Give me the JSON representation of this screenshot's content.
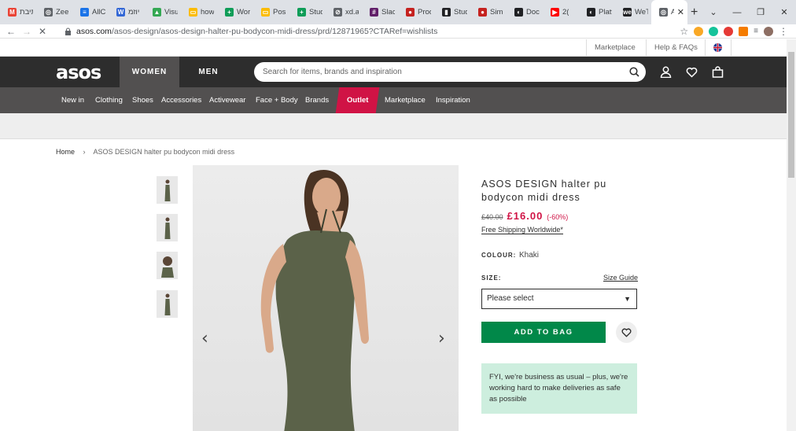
{
  "browser": {
    "tabs": [
      {
        "title": "תיבת",
        "color": "#ea4335",
        "glyph": "M"
      },
      {
        "title": "Zeek",
        "color": "#5f6368",
        "glyph": "◎"
      },
      {
        "title": "AllCu",
        "color": "#1a73e8",
        "glyph": "≡"
      },
      {
        "title": "יוזמ",
        "color": "#3367d6",
        "glyph": "W"
      },
      {
        "title": "Visua",
        "color": "#34a853",
        "glyph": "▲"
      },
      {
        "title": "how t",
        "color": "#fbbc04",
        "glyph": "▭"
      },
      {
        "title": "Work",
        "color": "#0f9d58",
        "glyph": "+"
      },
      {
        "title": "Positi",
        "color": "#fbbc04",
        "glyph": "▭"
      },
      {
        "title": "Studi",
        "color": "#0f9d58",
        "glyph": "+"
      },
      {
        "title": "xd.ad",
        "color": "#5f6368",
        "glyph": "⊘"
      },
      {
        "title": "Slack",
        "color": "#611f69",
        "glyph": "#"
      },
      {
        "title": "Prod",
        "color": "#c5221f",
        "glyph": "●"
      },
      {
        "title": "Studi",
        "color": "#202124",
        "glyph": "▮"
      },
      {
        "title": "Simu",
        "color": "#c5221f",
        "glyph": "●"
      },
      {
        "title": "Docu",
        "color": "#202124",
        "glyph": "◐"
      },
      {
        "title": "2(",
        "color": "#ff0000",
        "glyph": "▶"
      },
      {
        "title": "Platf",
        "color": "#202124",
        "glyph": "◐"
      },
      {
        "title": "WeTr",
        "color": "#202124",
        "glyph": "we"
      },
      {
        "title": "A",
        "color": "#5f6368",
        "glyph": "◎"
      }
    ],
    "new_tab": "+",
    "url_host": "asos.com",
    "url_path": "/asos-design/asos-design-halter-pu-bodycon-midi-dress/prd/12871965?CTARef=wishlists"
  },
  "utility": {
    "marketplace": "Marketplace",
    "help": "Help & FAQs"
  },
  "header": {
    "logo": "asos",
    "women": "WOMEN",
    "men": "MEN",
    "search_placeholder": "Search for items, brands and inspiration"
  },
  "categories": [
    "New in",
    "Clothing",
    "Shoes",
    "Accessories",
    "Activewear",
    "Face + Body",
    "Brands",
    "Outlet",
    "Marketplace",
    "Inspiration"
  ],
  "breadcrumb": {
    "home": "Home",
    "sep": "›",
    "current": "ASOS DESIGN halter pu bodycon midi dress"
  },
  "product": {
    "title": "ASOS DESIGN halter pu bodycon midi dress",
    "was_price": "£40.00",
    "now_price": "£16.00",
    "discount": "(-60%)",
    "shipping": "Free Shipping Worldwide*",
    "colour_label": "COLOUR:",
    "colour_value": "Khaki",
    "size_label": "SIZE:",
    "size_guide": "Size Guide",
    "size_select": "Please select",
    "add_to_bag": "ADD TO BAG",
    "notice": "FYI, we're business as usual – plus, we're working hard to make deliveries as safe as possible"
  },
  "colors": {
    "outlet": "#d01345",
    "add_to_bag": "#018849",
    "notice_bg": "#cdeede",
    "nav_dark": "#2d2d2d",
    "nav_grey": "#525050"
  }
}
